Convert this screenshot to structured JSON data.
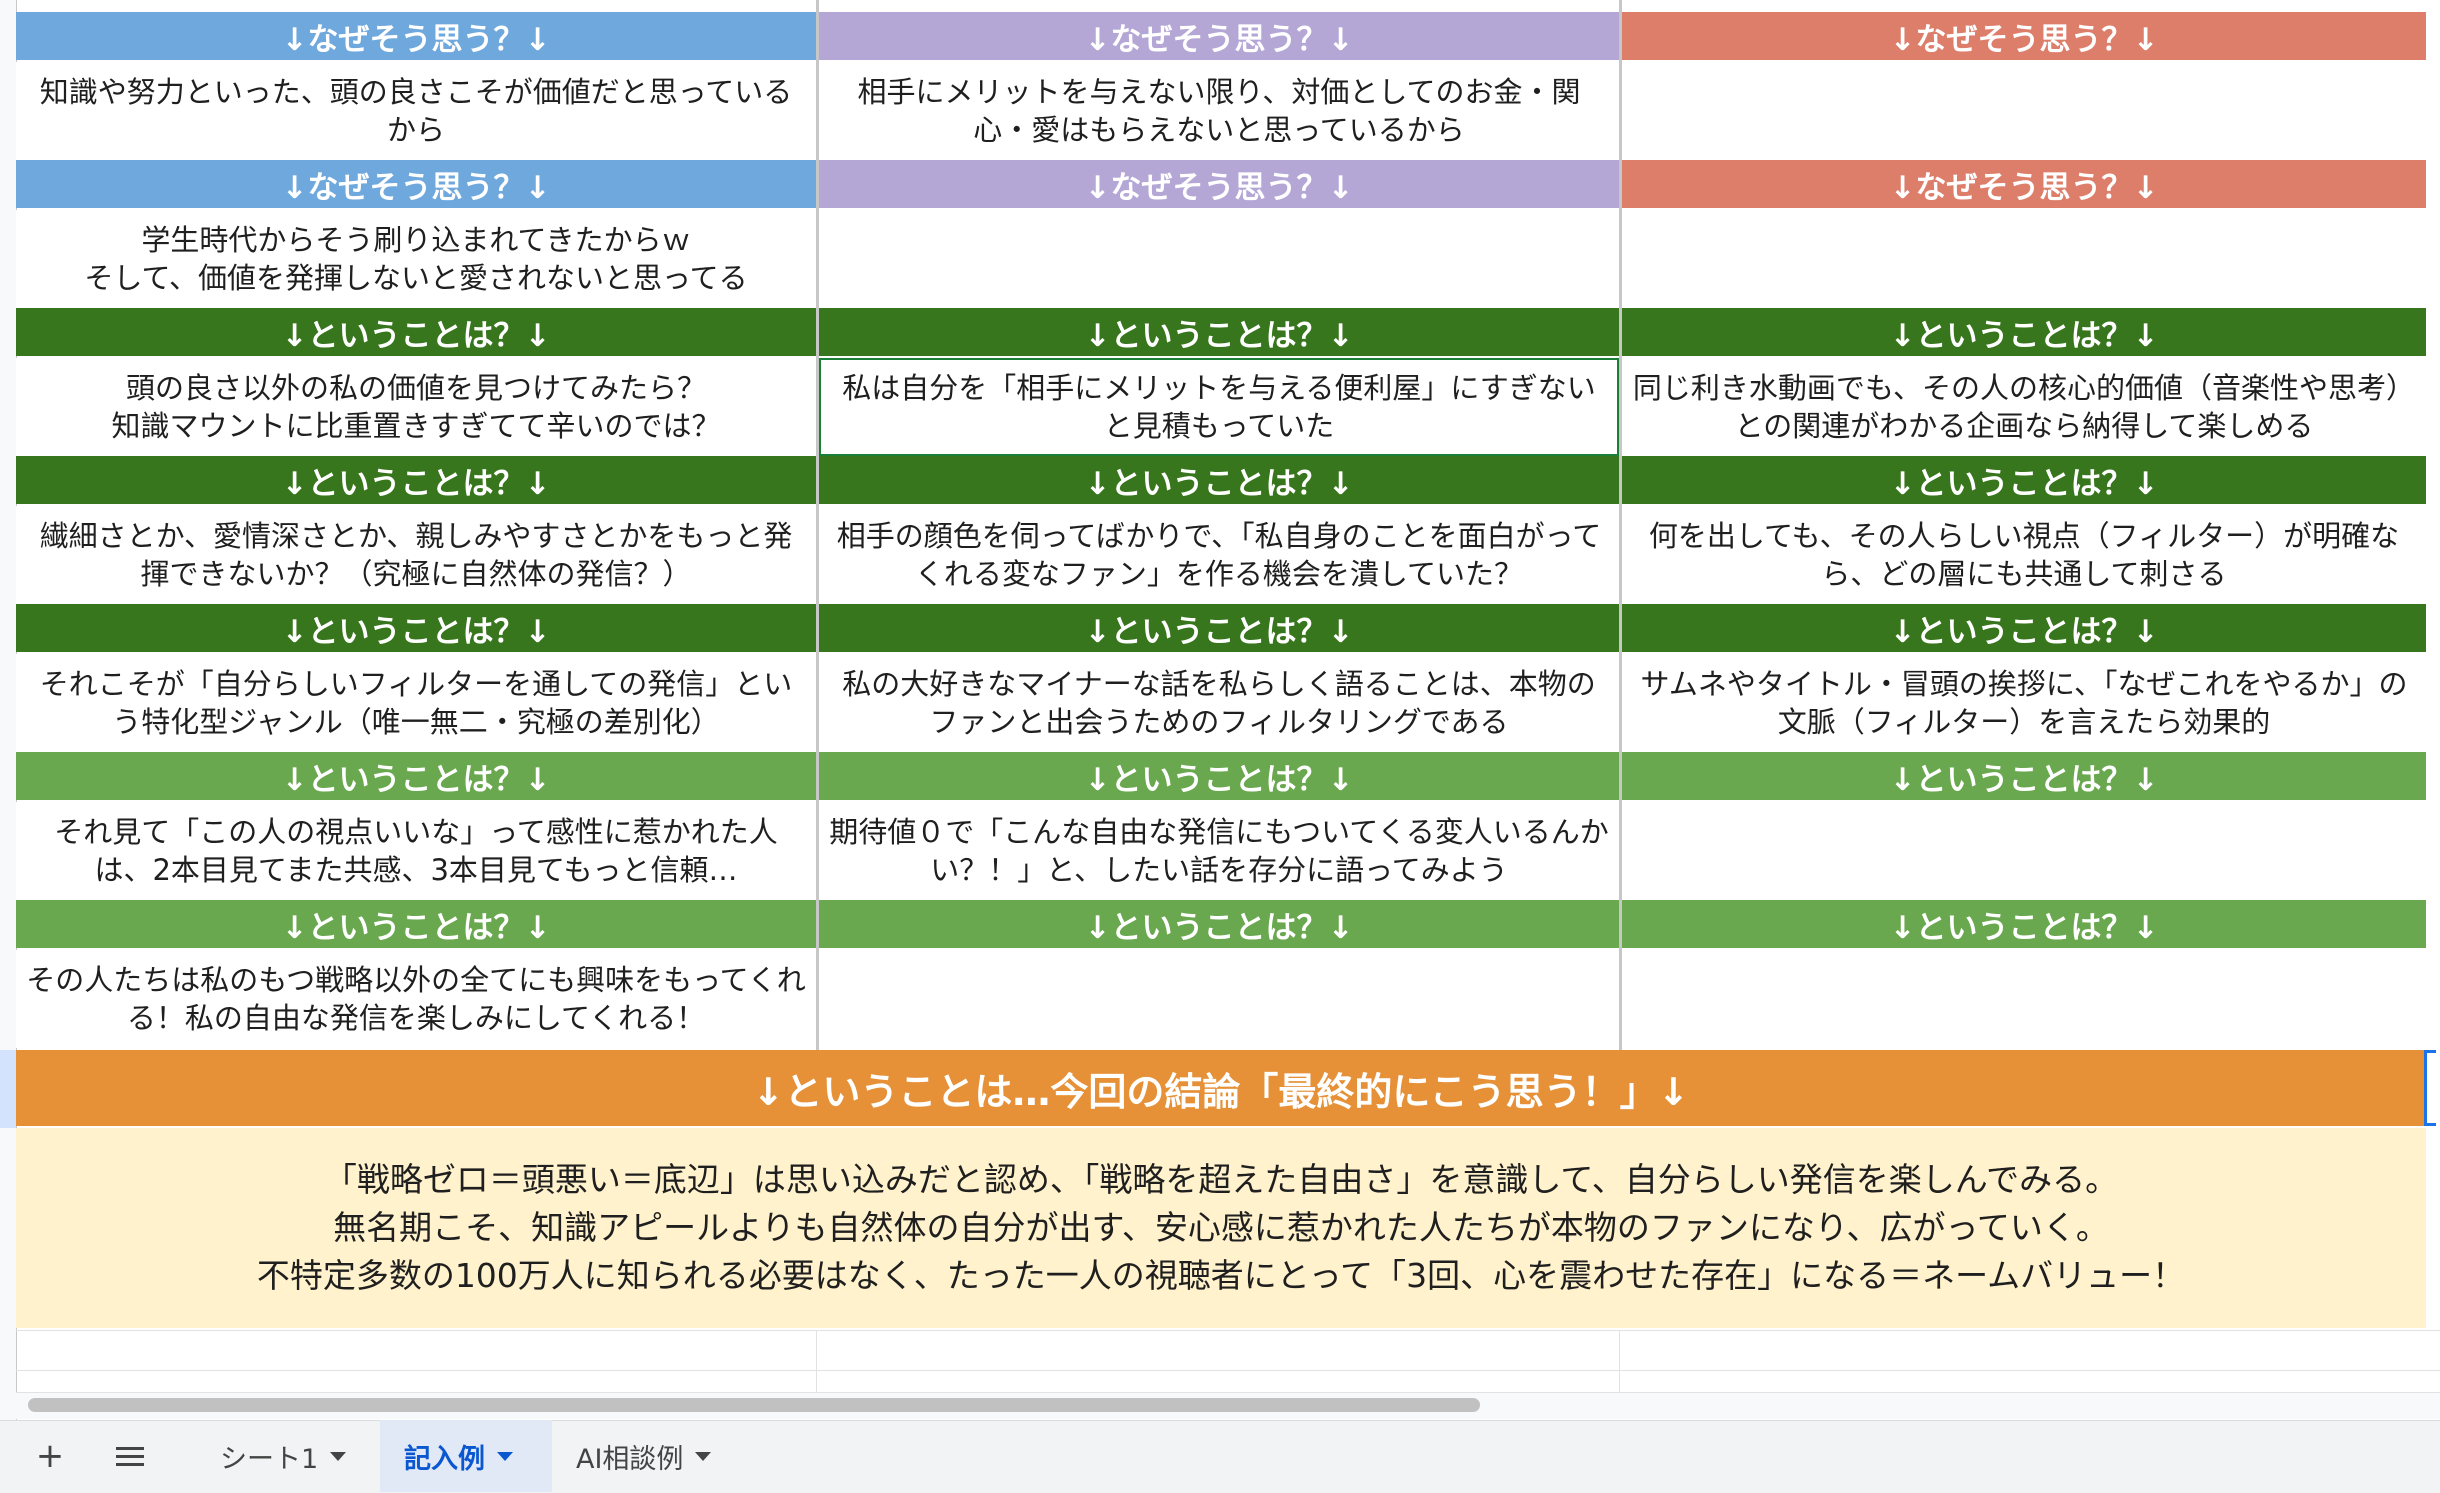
{
  "headers": {
    "why": "↓なぜそう思う？↓",
    "so": "↓ということは？↓"
  },
  "rows": [
    [
      "知識や努力といった、頭の良さこそが価値だと思っているから",
      "相手にメリットを与えない限り、対価としてのお金・関心・愛はもらえないと思っているから",
      ""
    ],
    [
      "学生時代からそう刷り込まれてきたからｗ\nそして、価値を発揮しないと愛されないと思ってる",
      "",
      ""
    ],
    [
      "頭の良さ以外の私の価値を見つけてみたら？\n知識マウントに比重置きすぎてて辛いのでは？",
      "私は自分を「相手にメリットを与える便利屋」にすぎないと見積もっていた",
      "同じ利き水動画でも、その人の核心的価値（音楽性や思考）との関連がわかる企画なら納得して楽しめる"
    ],
    [
      "繊細さとか、愛情深さとか、親しみやすさとかをもっと発揮できないか？（究極に自然体の発信？）",
      "相手の顔色を伺ってばかりで、「私自身のことを面白がってくれる変なファン」を作る機会を潰していた？",
      "何を出しても、その人らしい視点（フィルター）が明確なら、どの層にも共通して刺さる"
    ],
    [
      "それこそが「自分らしいフィルターを通しての発信」という特化型ジャンル（唯一無二・究極の差別化）",
      "私の大好きなマイナーな話を私らしく語ることは、本物のファンと出会うためのフィルタリングである",
      "サムネやタイトル・冒頭の挨拶に、「なぜこれをやるか」の文脈（フィルター）を言えたら効果的"
    ],
    [
      "それ見て「この人の視点いいな」って感性に惹かれた人は、2本目見てまた共感、3本目見てもっと信頼…",
      "期待値０で「こんな自由な発信にもついてくる変人いるんかい？！」と、したい話を存分に語ってみよう",
      ""
    ],
    [
      "その人たちは私のもつ戦略以外の全てにも興味をもってくれる！私の自由な発信を楽しみにしてくれる！",
      "",
      ""
    ]
  ],
  "conclusion": {
    "title": "↓ということは…今回の結論「最終的にこう思う！」↓",
    "lines": [
      "「戦略ゼロ＝頭悪い＝底辺」は思い込みだと認め、「戦略を超えた自由さ」を意識して、自分らしい発信を楽しんでみる。",
      "無名期こそ、知識アピールよりも自然体の自分が出す、安心感に惹かれた人たちが本物のファンになり、広がっていく。",
      "不特定多数の100万人に知られる必要はなく、たった一人の視聴者にとって「3回、心を震わせた存在」になる＝ネームバリュー！"
    ]
  },
  "tabs": {
    "add_label": "+",
    "items": [
      "シート1",
      "記入例",
      "AI相談例"
    ],
    "active_index": 1
  },
  "colors": {
    "blue": "#6fa8dc",
    "purple": "#b4a7d6",
    "red": "#dd7e6b",
    "dark_green": "#38761d",
    "light_green": "#6aa84f",
    "orange": "#e69138",
    "cream": "#fff2cc"
  }
}
